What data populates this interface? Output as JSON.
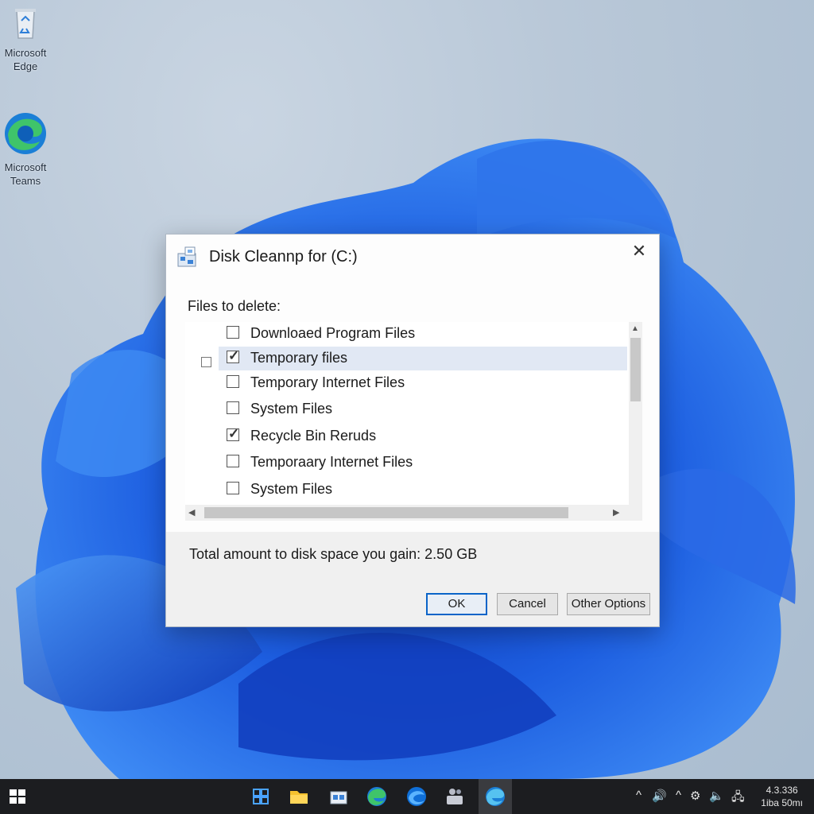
{
  "desktop": {
    "icons": [
      {
        "label": "Microsoft\nEdge",
        "icon": "recycle-bin-icon"
      },
      {
        "label": "Microsoft\nTeams",
        "icon": "edge-icon"
      }
    ]
  },
  "dialog": {
    "title": "Disk Cleannp for (C:)",
    "close_glyph": "✕",
    "files_label": "Files to delete:",
    "items": [
      {
        "label": "Downloaed Program Files",
        "checked": false
      },
      {
        "label": "Temporary files",
        "checked": true,
        "selected": true
      },
      {
        "label": "Temporary Internet Files",
        "checked": false
      },
      {
        "label": "System Files",
        "checked": false
      },
      {
        "label": "Recycle Bin Reruds",
        "checked": true
      },
      {
        "label": "Temporaary Internet Files",
        "checked": false
      },
      {
        "label": "System Files",
        "checked": false
      }
    ],
    "total_text": "Total amount to disk space you gain: 2.50 GB",
    "buttons": {
      "ok": "OK",
      "cancel": "Cancel",
      "other": "Other Options"
    }
  },
  "taskbar": {
    "apps": [
      "start-icon",
      "task-view-icon",
      "file-explorer-icon",
      "store-icon",
      "edge-icon",
      "edge-beta-icon",
      "teams-icon",
      "edge-dev-icon"
    ],
    "tray": [
      "^",
      "🔊",
      "^",
      "⚙",
      "🔈",
      "🖧"
    ],
    "clock_time": "4.3.336",
    "clock_date": "1iba 50mı"
  },
  "colors": {
    "accent": "#0a64c8",
    "taskbar": "#1c1d20",
    "selection": "#e1e8f4"
  }
}
